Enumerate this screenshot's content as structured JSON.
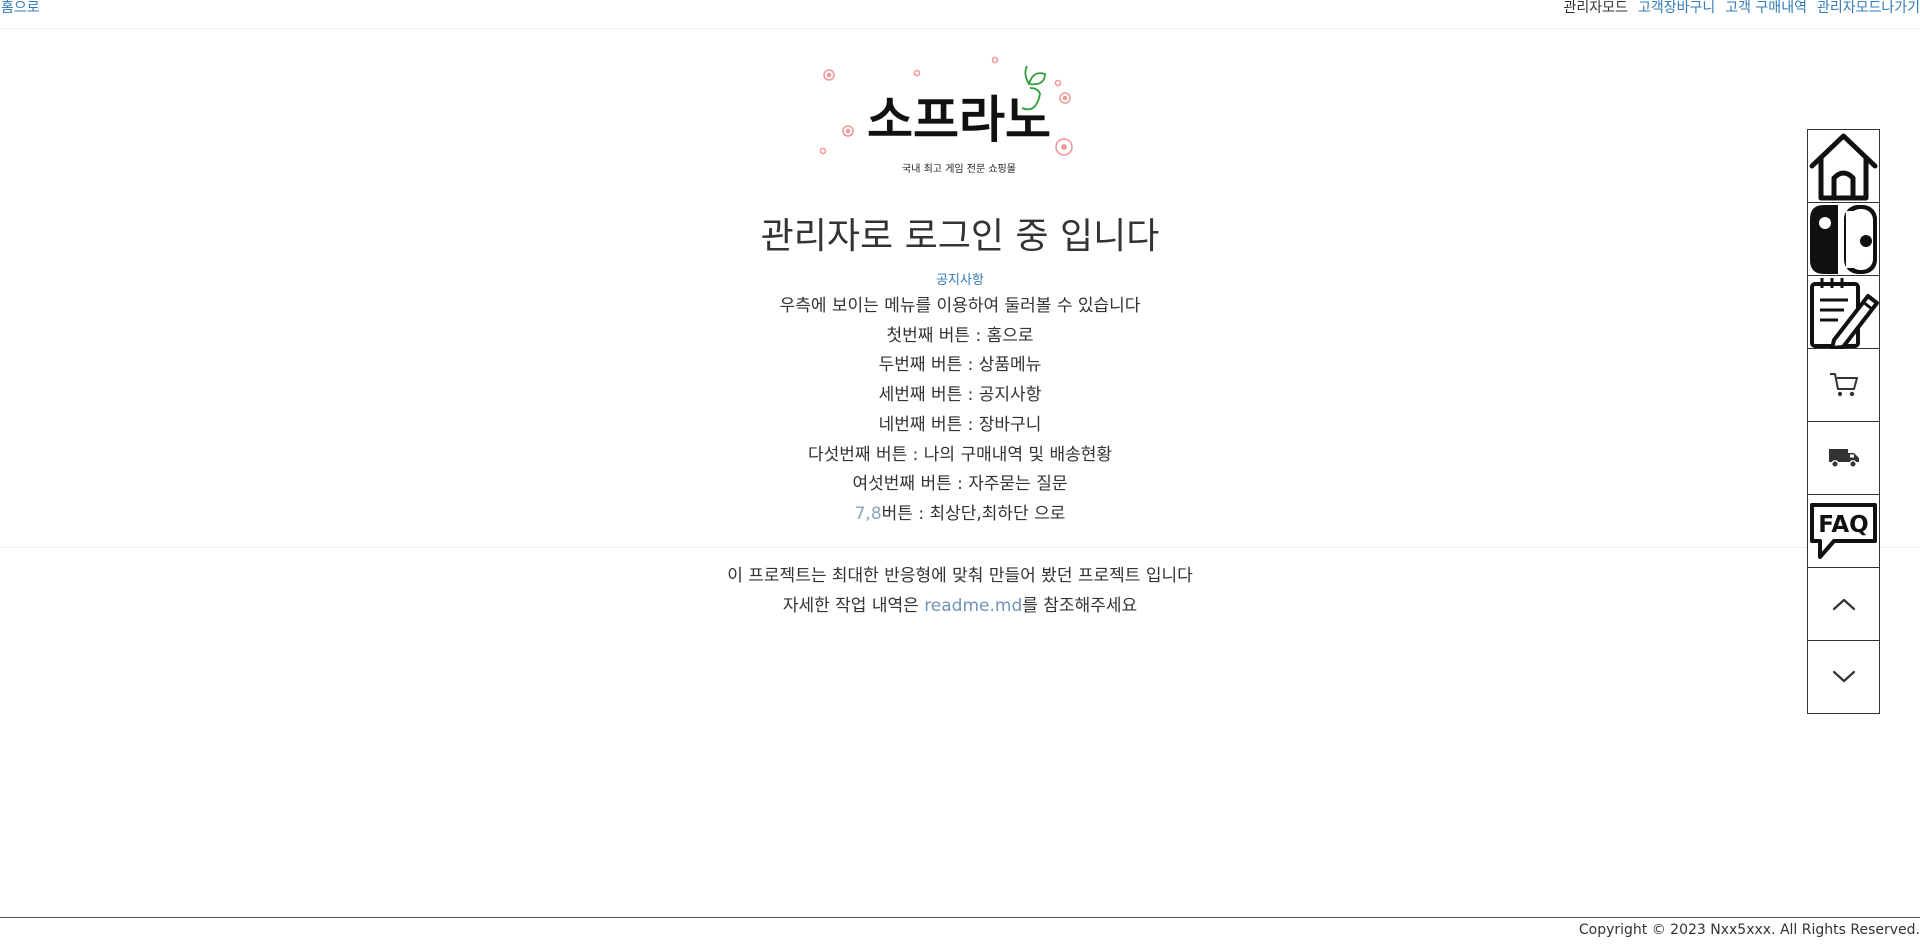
{
  "topbar": {
    "home_link": "홈으로",
    "admin_mode": "관리자모드",
    "customer_cart": "고객장바구니",
    "customer_orders": "고객 구매내역",
    "admin_exit": "관리자모드나가기"
  },
  "logo": {
    "wordmark": "소프라노",
    "tagline": "국내 최고 게임 전문 쇼핑몰"
  },
  "main": {
    "title": "관리자로 로그인 중 입니다",
    "notice_link": "공지사항",
    "guide": [
      "우측에 보이는 메뉴를 이용하여 둘러볼 수 있습니다",
      "첫번째 버튼 : 홈으로",
      "두번째 버튼 : 상품메뉴",
      "세번째 버튼 : 공지사항",
      "네번째 버튼 : 장바구니",
      "다섯번째 버튼 : 나의 구매내역 및 배송현황",
      "여섯번째 버튼 : 자주묻는 질문"
    ],
    "guide_last": {
      "highlight": "7,8",
      "rest": "버튼 : 최상단,최하단 으로"
    }
  },
  "project": {
    "line1": "이 프로젝트는 최대한 반응형에 맞춰 만들어 봤던 프로젝트 입니다",
    "line2_prefix": "자세한 작업 내역은 ",
    "readme_link": "readme.md",
    "line2_suffix": "를 참조해주세요"
  },
  "footer": {
    "copyright": "Copyright © 2023 Nxx5xxx. All Rights Reserved."
  },
  "quick_menu": {
    "icons": [
      "home-icon",
      "game-console-icon",
      "notepad-pencil-icon",
      "cart-icon",
      "truck-icon",
      "faq-icon",
      "chevron-up-icon",
      "chevron-down-icon"
    ]
  },
  "colors": {
    "link": "#337ab7",
    "text": "#333333",
    "highlight": "#8aa6bf",
    "flower": "#f19a9a",
    "sprout": "#2e9e3a"
  }
}
